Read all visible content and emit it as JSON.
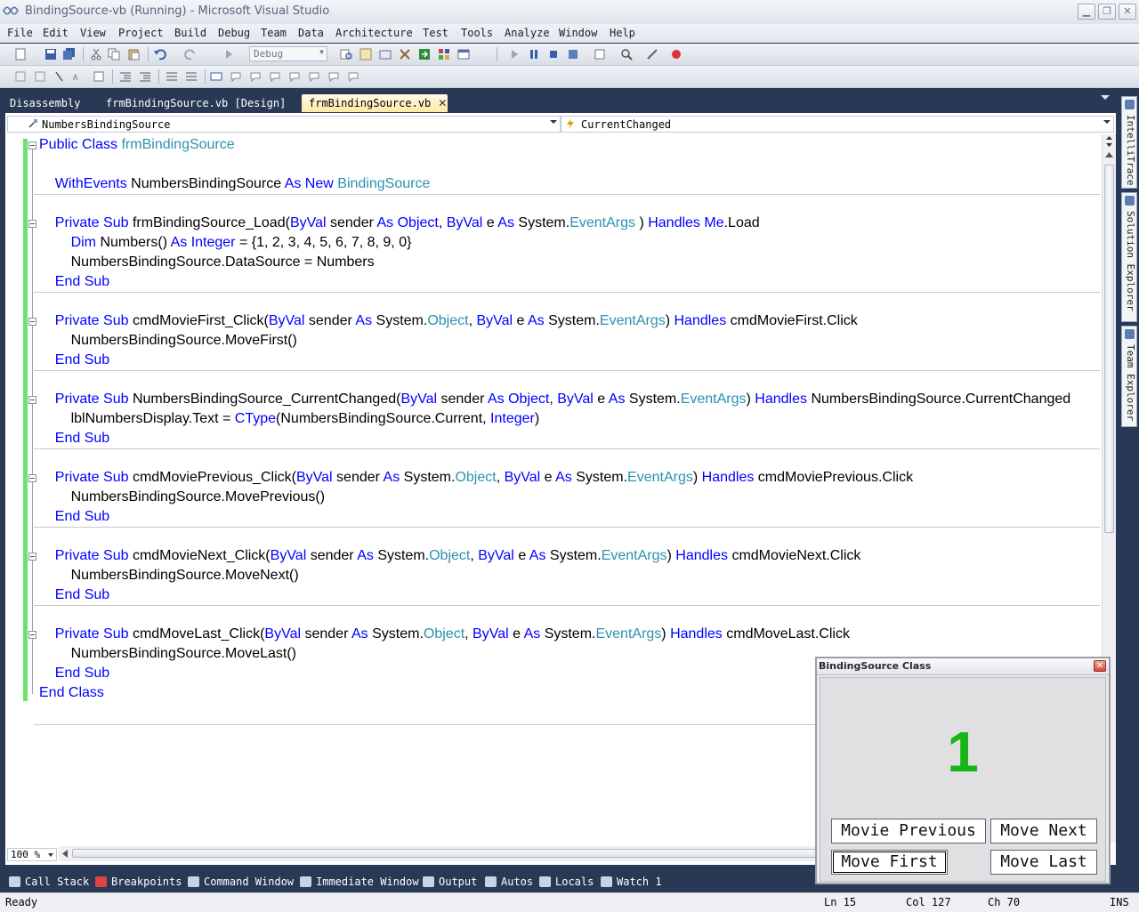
{
  "window": {
    "title": "BindingSource-vb (Running) - Microsoft Visual Studio"
  },
  "menu": [
    "File",
    "Edit",
    "View",
    "Project",
    "Build",
    "Debug",
    "Team",
    "Data",
    "Architecture",
    "Test",
    "Tools",
    "Analyze",
    "Window",
    "Help"
  ],
  "toolbar": {
    "solution_configuration": "Debug"
  },
  "tabs": [
    {
      "label": "Disassembly",
      "active": false
    },
    {
      "label": "frmBindingSource.vb [Design]",
      "active": false
    },
    {
      "label": "frmBindingSource.vb",
      "active": true,
      "close": "✕"
    }
  ],
  "navigation": {
    "object": "NumbersBindingSource",
    "member": "CurrentChanged"
  },
  "code": [
    [
      [
        "kw",
        "Public Class "
      ],
      [
        "ty",
        "frmBindingSource"
      ]
    ],
    [],
    [
      [
        "",
        "    "
      ],
      [
        "kw",
        "WithEvents "
      ],
      [
        "",
        "NumbersBindingSource "
      ],
      [
        "kw",
        "As New "
      ],
      [
        "ty",
        "BindingSource"
      ]
    ],
    [],
    [
      [
        "",
        "    "
      ],
      [
        "kw",
        "Private Sub "
      ],
      [
        "",
        "frmBindingSource_Load("
      ],
      [
        "kw",
        "ByVal "
      ],
      [
        "",
        "sender "
      ],
      [
        "kw",
        "As Object"
      ],
      [
        "",
        ", "
      ],
      [
        "kw",
        "ByVal "
      ],
      [
        "",
        "e "
      ],
      [
        "kw",
        "As "
      ],
      [
        "",
        "System."
      ],
      [
        "ty",
        "EventArgs"
      ],
      [
        "",
        " ) "
      ],
      [
        "kw",
        "Handles Me"
      ],
      [
        "",
        ".Load"
      ]
    ],
    [
      [
        "",
        "        "
      ],
      [
        "kw",
        "Dim "
      ],
      [
        "",
        "Numbers() "
      ],
      [
        "kw",
        "As Integer "
      ],
      [
        "",
        "= {1, 2, 3, 4, 5, 6, 7, 8, 9, 0}"
      ]
    ],
    [
      [
        "",
        "        NumbersBindingSource.DataSource = Numbers"
      ]
    ],
    [
      [
        "",
        "    "
      ],
      [
        "kw",
        "End Sub"
      ]
    ],
    [],
    [
      [
        "",
        "    "
      ],
      [
        "kw",
        "Private Sub "
      ],
      [
        "",
        "cmdMovieFirst_Click("
      ],
      [
        "kw",
        "ByVal "
      ],
      [
        "",
        "sender "
      ],
      [
        "kw",
        "As "
      ],
      [
        "",
        "System."
      ],
      [
        "ty",
        "Object"
      ],
      [
        "",
        ", "
      ],
      [
        "kw",
        "ByVal "
      ],
      [
        "",
        "e "
      ],
      [
        "kw",
        "As "
      ],
      [
        "",
        "System."
      ],
      [
        "ty",
        "EventArgs"
      ],
      [
        "",
        ") "
      ],
      [
        "kw",
        "Handles "
      ],
      [
        "",
        "cmdMovieFirst.Click"
      ]
    ],
    [
      [
        "",
        "        NumbersBindingSource.MoveFirst()"
      ]
    ],
    [
      [
        "",
        "    "
      ],
      [
        "kw",
        "End Sub"
      ]
    ],
    [],
    [
      [
        "",
        "    "
      ],
      [
        "kw",
        "Private Sub "
      ],
      [
        "",
        "NumbersBindingSource_CurrentChanged("
      ],
      [
        "kw",
        "ByVal "
      ],
      [
        "",
        "sender "
      ],
      [
        "kw",
        "As Object"
      ],
      [
        "",
        ", "
      ],
      [
        "kw",
        "ByVal "
      ],
      [
        "",
        "e "
      ],
      [
        "kw",
        "As "
      ],
      [
        "",
        "System."
      ],
      [
        "ty",
        "EventArgs"
      ],
      [
        "",
        ") "
      ],
      [
        "kw",
        "Handles "
      ],
      [
        "",
        "NumbersBindingSource.CurrentChanged"
      ]
    ],
    [
      [
        "",
        "        lblNumbersDisplay.Text = "
      ],
      [
        "kw",
        "CType"
      ],
      [
        "",
        "(NumbersBindingSource.Current, "
      ],
      [
        "kw",
        "Integer"
      ],
      [
        "",
        ")"
      ]
    ],
    [
      [
        "",
        "    "
      ],
      [
        "kw",
        "End Sub"
      ]
    ],
    [],
    [
      [
        "",
        "    "
      ],
      [
        "kw",
        "Private Sub "
      ],
      [
        "",
        "cmdMoviePrevious_Click("
      ],
      [
        "kw",
        "ByVal "
      ],
      [
        "",
        "sender "
      ],
      [
        "kw",
        "As "
      ],
      [
        "",
        "System."
      ],
      [
        "ty",
        "Object"
      ],
      [
        "",
        ", "
      ],
      [
        "kw",
        "ByVal "
      ],
      [
        "",
        "e "
      ],
      [
        "kw",
        "As "
      ],
      [
        "",
        "System."
      ],
      [
        "ty",
        "EventArgs"
      ],
      [
        "",
        ") "
      ],
      [
        "kw",
        "Handles "
      ],
      [
        "",
        "cmdMoviePrevious.Click"
      ]
    ],
    [
      [
        "",
        "        NumbersBindingSource.MovePrevious()"
      ]
    ],
    [
      [
        "",
        "    "
      ],
      [
        "kw",
        "End Sub"
      ]
    ],
    [],
    [
      [
        "",
        "    "
      ],
      [
        "kw",
        "Private Sub "
      ],
      [
        "",
        "cmdMovieNext_Click("
      ],
      [
        "kw",
        "ByVal "
      ],
      [
        "",
        "sender "
      ],
      [
        "kw",
        "As "
      ],
      [
        "",
        "System."
      ],
      [
        "ty",
        "Object"
      ],
      [
        "",
        ", "
      ],
      [
        "kw",
        "ByVal "
      ],
      [
        "",
        "e "
      ],
      [
        "kw",
        "As "
      ],
      [
        "",
        "System."
      ],
      [
        "ty",
        "EventArgs"
      ],
      [
        "",
        ") "
      ],
      [
        "kw",
        "Handles "
      ],
      [
        "",
        "cmdMovieNext.Click"
      ]
    ],
    [
      [
        "",
        "        NumbersBindingSource.MoveNext()"
      ]
    ],
    [
      [
        "",
        "    "
      ],
      [
        "kw",
        "End Sub"
      ]
    ],
    [],
    [
      [
        "",
        "    "
      ],
      [
        "kw",
        "Private Sub "
      ],
      [
        "",
        "cmdMoveLast_Click("
      ],
      [
        "kw",
        "ByVal "
      ],
      [
        "",
        "sender "
      ],
      [
        "kw",
        "As "
      ],
      [
        "",
        "System."
      ],
      [
        "ty",
        "Object"
      ],
      [
        "",
        ", "
      ],
      [
        "kw",
        "ByVal "
      ],
      [
        "",
        "e "
      ],
      [
        "kw",
        "As "
      ],
      [
        "",
        "System."
      ],
      [
        "ty",
        "EventArgs"
      ],
      [
        "",
        ") "
      ],
      [
        "kw",
        "Handles "
      ],
      [
        "",
        "cmdMoveLast.Click"
      ]
    ],
    [
      [
        "",
        "        NumbersBindingSource.MoveLast()"
      ]
    ],
    [
      [
        "",
        "    "
      ],
      [
        "kw",
        "End Sub"
      ]
    ],
    [
      [
        "kw",
        "End Class"
      ]
    ]
  ],
  "editor": {
    "zoom": "100 %"
  },
  "side_tabs": [
    "IntelliTrace",
    "Solution Explorer",
    "Team Explorer"
  ],
  "bottom_tabs": [
    "Call Stack",
    "Breakpoints",
    "Command Window",
    "Immediate Window",
    "Output",
    "Autos",
    "Locals",
    "Watch 1"
  ],
  "status": {
    "state": "Ready",
    "line": "Ln 15",
    "col": "Col 127",
    "ch": "Ch 70",
    "mode": "INS"
  },
  "form": {
    "title": "BindingSource Class",
    "display_value": "1",
    "buttons": {
      "previous": "Movie Previous",
      "next": "Move Next",
      "first": "Move First",
      "last": "Move Last"
    }
  },
  "colors": {
    "keyword": "#0000ff",
    "type": "#2b91af",
    "display": "#17b517",
    "chrome": "#293955"
  }
}
